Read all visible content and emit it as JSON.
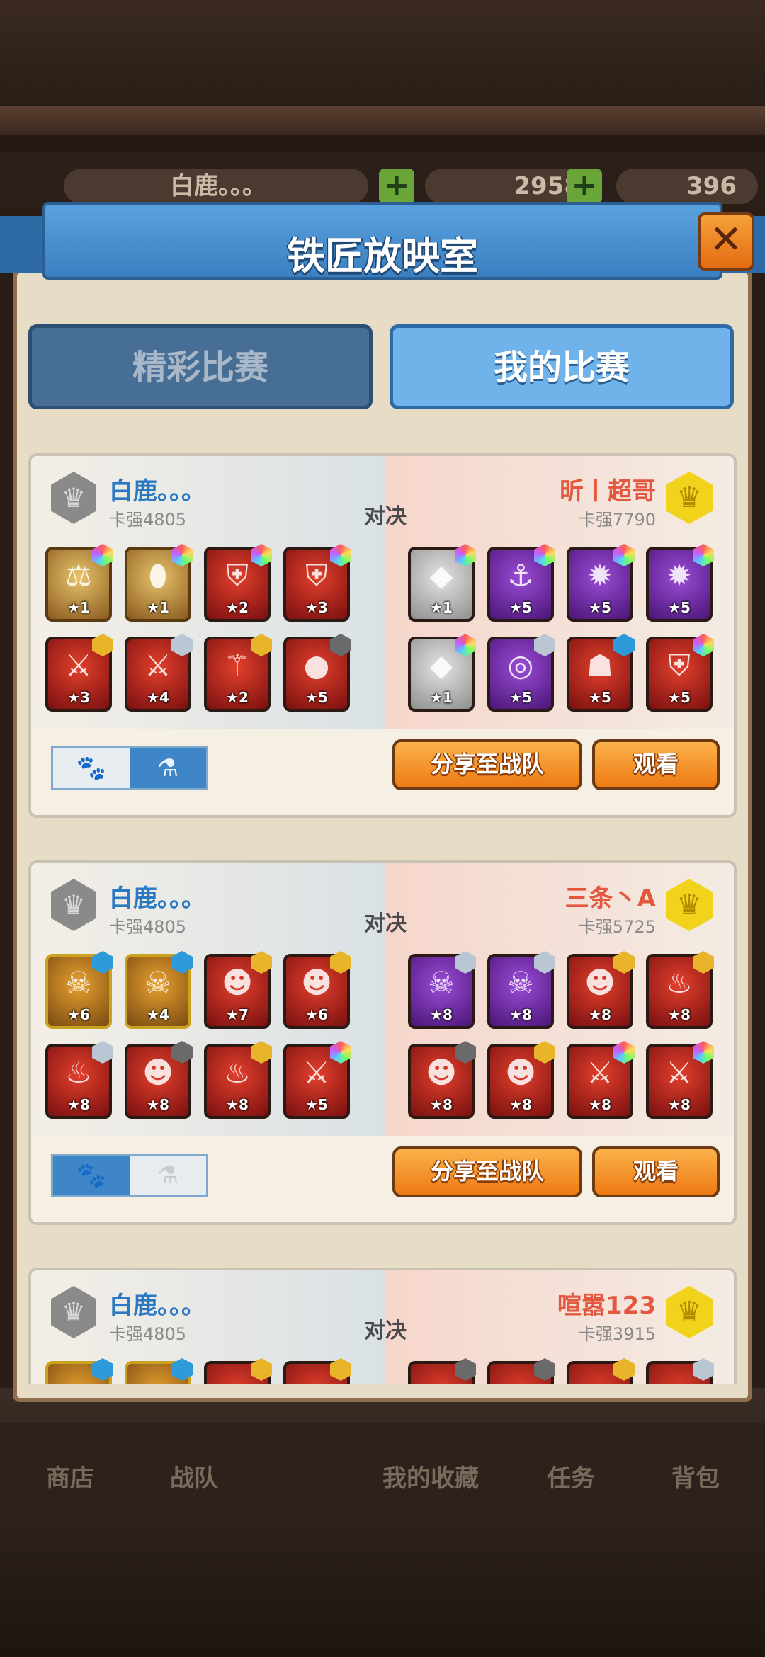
{
  "background": {
    "player_name": "白鹿。。。",
    "currency1": "2958",
    "currency2": "396",
    "nav": [
      "商店",
      "战队",
      "我的收藏",
      "任务",
      "背包"
    ]
  },
  "dialog": {
    "title": "铁匠放映室",
    "tabs": [
      {
        "label": "精彩比赛",
        "active": false
      },
      {
        "label": "我的比赛",
        "active": true
      }
    ]
  },
  "vs_label": "对决",
  "share_label": "分享至战队",
  "watch_label": "观看",
  "matches": [
    {
      "left": {
        "name": "白鹿。。。",
        "score": "卡强4805"
      },
      "right": {
        "name": "昕丨超哥",
        "score": "卡强7790"
      },
      "mode": "right",
      "left_items": [
        {
          "stars": "★1",
          "rarity": "gold",
          "gem": "rainbow",
          "icon": "⚖"
        },
        {
          "stars": "★1",
          "rarity": "gold",
          "gem": "rainbow",
          "icon": "⬮"
        },
        {
          "stars": "★2",
          "rarity": "red",
          "gem": "rainbow",
          "icon": "⛨"
        },
        {
          "stars": "★3",
          "rarity": "red",
          "gem": "rainbow",
          "icon": "⛨"
        },
        {
          "stars": "★3",
          "rarity": "red",
          "gem": "gold",
          "icon": "⚔"
        },
        {
          "stars": "★4",
          "rarity": "red",
          "gem": "silver",
          "icon": "⚔"
        },
        {
          "stars": "★2",
          "rarity": "red",
          "gem": "gold",
          "icon": "⚚"
        },
        {
          "stars": "★5",
          "rarity": "red",
          "gem": "dark",
          "icon": "●"
        }
      ],
      "right_items": [
        {
          "stars": "★1",
          "rarity": "gray",
          "gem": "rainbow",
          "icon": "◆"
        },
        {
          "stars": "★5",
          "rarity": "purple",
          "gem": "rainbow",
          "icon": "⚓"
        },
        {
          "stars": "★5",
          "rarity": "purple",
          "gem": "rainbow",
          "icon": "✹"
        },
        {
          "stars": "★5",
          "rarity": "purple",
          "gem": "rainbow",
          "icon": "✹"
        },
        {
          "stars": "★1",
          "rarity": "gray",
          "gem": "rainbow",
          "icon": "◆"
        },
        {
          "stars": "★5",
          "rarity": "purple",
          "gem": "silver",
          "icon": "◎"
        },
        {
          "stars": "★5",
          "rarity": "red",
          "gem": "star",
          "icon": "☗"
        },
        {
          "stars": "★5",
          "rarity": "red",
          "gem": "rainbow",
          "icon": "⛨"
        }
      ]
    },
    {
      "left": {
        "name": "白鹿。。。",
        "score": "卡强4805"
      },
      "right": {
        "name": "三条丶A",
        "score": "卡强5725"
      },
      "mode": "left",
      "left_items": [
        {
          "stars": "★6",
          "rarity": "yellow",
          "gem": "star",
          "icon": "☠"
        },
        {
          "stars": "★4",
          "rarity": "yellow",
          "gem": "star",
          "icon": "☠"
        },
        {
          "stars": "★7",
          "rarity": "red",
          "gem": "gold",
          "icon": "☻"
        },
        {
          "stars": "★6",
          "rarity": "red",
          "gem": "gold",
          "icon": "☻"
        },
        {
          "stars": "★8",
          "rarity": "red",
          "gem": "silver",
          "icon": "♨"
        },
        {
          "stars": "★8",
          "rarity": "red",
          "gem": "dark",
          "icon": "☻"
        },
        {
          "stars": "★8",
          "rarity": "red",
          "gem": "gold",
          "icon": "♨"
        },
        {
          "stars": "★5",
          "rarity": "red",
          "gem": "rainbow",
          "icon": "⚔"
        }
      ],
      "right_items": [
        {
          "stars": "★8",
          "rarity": "purple",
          "gem": "silver",
          "icon": "☠"
        },
        {
          "stars": "★8",
          "rarity": "purple",
          "gem": "silver",
          "icon": "☠"
        },
        {
          "stars": "★8",
          "rarity": "red",
          "gem": "gold",
          "icon": "☻"
        },
        {
          "stars": "★8",
          "rarity": "red",
          "gem": "gold",
          "icon": "♨"
        },
        {
          "stars": "★8",
          "rarity": "red",
          "gem": "dark",
          "icon": "☻"
        },
        {
          "stars": "★8",
          "rarity": "red",
          "gem": "gold",
          "icon": "☻"
        },
        {
          "stars": "★8",
          "rarity": "red",
          "gem": "rainbow",
          "icon": "⚔"
        },
        {
          "stars": "★8",
          "rarity": "red",
          "gem": "rainbow",
          "icon": "⚔"
        }
      ]
    },
    {
      "left": {
        "name": "白鹿。。。",
        "score": "卡强4805"
      },
      "right": {
        "name": "喧嚣123",
        "score": "卡强3915"
      },
      "mode": "left",
      "left_items": [
        {
          "stars": "",
          "rarity": "yellow",
          "gem": "star",
          "icon": ""
        },
        {
          "stars": "",
          "rarity": "yellow",
          "gem": "star",
          "icon": ""
        },
        {
          "stars": "",
          "rarity": "red",
          "gem": "gold",
          "icon": ""
        },
        {
          "stars": "",
          "rarity": "red",
          "gem": "gold",
          "icon": ""
        }
      ],
      "right_items": [
        {
          "stars": "",
          "rarity": "red",
          "gem": "dark",
          "icon": ""
        },
        {
          "stars": "",
          "rarity": "red",
          "gem": "dark",
          "icon": ""
        },
        {
          "stars": "",
          "rarity": "red",
          "gem": "gold",
          "icon": ""
        },
        {
          "stars": "",
          "rarity": "red",
          "gem": "silver",
          "icon": ""
        }
      ]
    }
  ]
}
